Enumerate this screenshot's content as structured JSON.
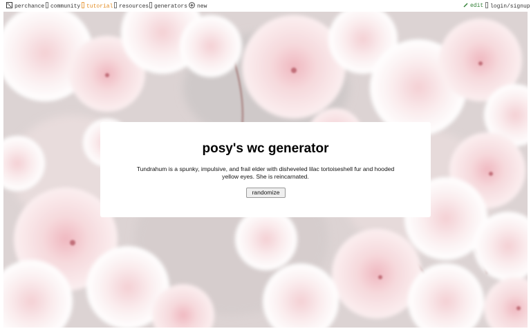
{
  "topbar": {
    "nav": [
      {
        "label": "perchance",
        "icon": "dice-icon"
      },
      {
        "label": "community",
        "icon": "community-icon"
      },
      {
        "label": "tutorial",
        "icon": "tutorial-icon"
      },
      {
        "label": "resources",
        "icon": "resources-icon"
      },
      {
        "label": "generators",
        "icon": "generators-icon"
      },
      {
        "label": "new",
        "icon": "plus-circle-icon"
      }
    ],
    "edit_label": "edit",
    "login_label": "login/signup"
  },
  "colors": {
    "tutorial_link": "#e28a1f",
    "edit_link": "#2e7d32",
    "blossom_pink": "#f2c9cd",
    "background": "#e3d9d9"
  },
  "card": {
    "title": "posy's wc generator",
    "description": "Tundrahum is a spunky, impulsive, and frail elder with disheveled lilac tortoiseshell fur and hooded yellow eyes. She is reincarnated.",
    "button_label": "randomize"
  }
}
